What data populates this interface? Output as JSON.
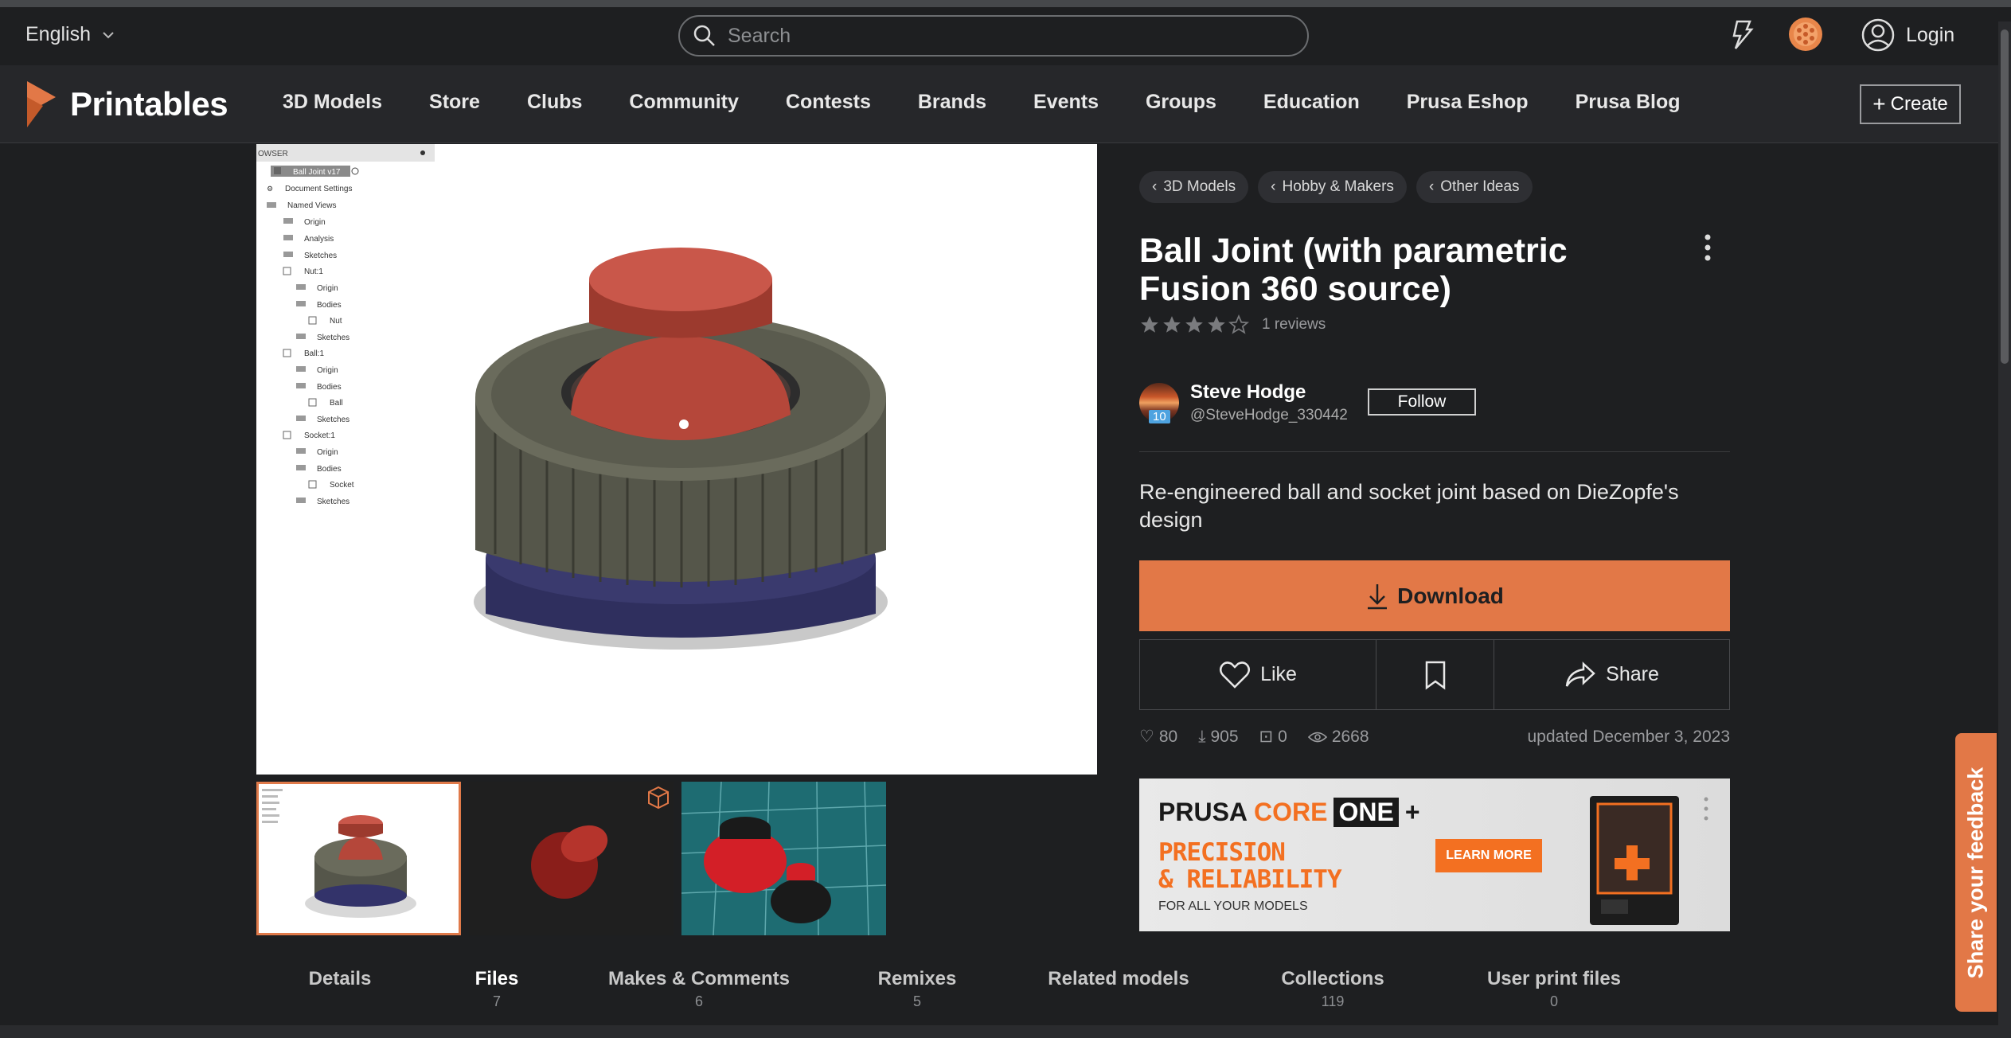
{
  "topbar": {
    "language": "English",
    "search_placeholder": "Search",
    "login_label": "Login"
  },
  "nav": {
    "brand": "Printables",
    "items": [
      "3D Models",
      "Store",
      "Clubs",
      "Community",
      "Contests",
      "Brands",
      "Events",
      "Groups",
      "Education",
      "Prusa Eshop",
      "Prusa Blog"
    ],
    "create_label": "Create"
  },
  "tree": {
    "header": "OWSER",
    "rows": [
      "Ball Joint v17",
      "Document Settings",
      "Named Views",
      "Origin",
      "Analysis",
      "Sketches",
      "Nut:1",
      "Origin",
      "Bodies",
      "Nut",
      "Sketches",
      "Ball:1",
      "Origin",
      "Bodies",
      "Ball",
      "Sketches",
      "Socket:1",
      "Origin",
      "Bodies",
      "Socket",
      "Sketches"
    ]
  },
  "breadcrumbs": [
    "3D Models",
    "Hobby & Makers",
    "Other Ideas"
  ],
  "model": {
    "title": "Ball Joint (with parametric Fusion 360 source)",
    "rating_value": 4,
    "reviews_label": "1 reviews",
    "description": "Re-engineered ball and socket joint based on DieZopfe's design"
  },
  "author": {
    "name": "Steve Hodge",
    "handle": "@SteveHodge_330442",
    "level": "10",
    "follow_label": "Follow"
  },
  "actions": {
    "download_label": "Download",
    "like_label": "Like",
    "share_label": "Share"
  },
  "stats": {
    "likes": "80",
    "downloads": "905",
    "makes": "0",
    "views": "2668",
    "updated": "updated December 3, 2023"
  },
  "ad": {
    "brand_prusa": "PRUSA",
    "brand_core": "CORE",
    "brand_one": "ONE",
    "brand_plus": "+",
    "tagline_1": "PRECISION",
    "tagline_2": "& RELIABILITY",
    "sub": "FOR ALL YOUR MODELS",
    "cta": "LEARN MORE"
  },
  "tabs": [
    {
      "label": "Details",
      "count": ""
    },
    {
      "label": "Files",
      "count": "7"
    },
    {
      "label": "Makes & Comments",
      "count": "6"
    },
    {
      "label": "Remixes",
      "count": "5"
    },
    {
      "label": "Related models",
      "count": ""
    },
    {
      "label": "Collections",
      "count": "119"
    },
    {
      "label": "User print files",
      "count": "0"
    }
  ],
  "feedback_label": "Share your feedback",
  "colors": {
    "accent": "#e27847",
    "background": "#1e1f21",
    "nav": "#26272a"
  }
}
